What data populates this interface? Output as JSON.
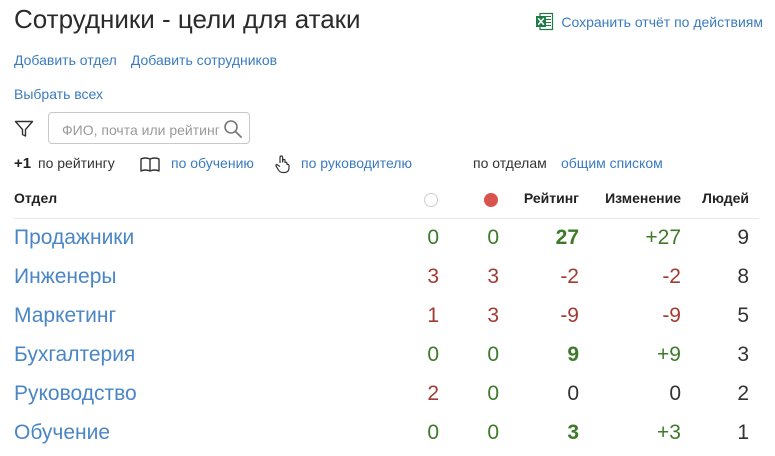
{
  "header": {
    "title": "Сотрудники - цели для атаки",
    "export_label": "Сохранить отчёт по действиям"
  },
  "actions": {
    "add_department": "Добавить отдел",
    "add_employees": "Добавить сотрудников",
    "select_all": "Выбрать всех"
  },
  "search": {
    "placeholder": "ФИО, почта или рейтинг",
    "value": ""
  },
  "sort": {
    "increment": "+1",
    "by_rating": "по рейтингу",
    "by_training": "по обучению",
    "by_manager": "по руководителю",
    "by_departments": "по отделам",
    "general_list": "общим списком"
  },
  "table": {
    "headers": {
      "department": "Отдел",
      "rating": "Рейтинг",
      "change": "Изменение",
      "people": "Людей"
    },
    "rows": [
      {
        "department": "Продажники",
        "col1": "0",
        "col2": "0",
        "rating": "27",
        "change": "+27",
        "people": "9"
      },
      {
        "department": "Инженеры",
        "col1": "3",
        "col2": "3",
        "rating": "-2",
        "change": "-2",
        "people": "8"
      },
      {
        "department": "Маркетинг",
        "col1": "1",
        "col2": "3",
        "rating": "-9",
        "change": "-9",
        "people": "5"
      },
      {
        "department": "Бухгалтерия",
        "col1": "0",
        "col2": "0",
        "rating": "9",
        "change": "+9",
        "people": "3"
      },
      {
        "department": "Руководство",
        "col1": "2",
        "col2": "0",
        "rating": "0",
        "change": "0",
        "people": "2"
      },
      {
        "department": "Обучение",
        "col1": "0",
        "col2": "0",
        "rating": "3",
        "change": "+3",
        "people": "1"
      }
    ]
  },
  "colors": {
    "link": "#3a7bbf",
    "positive": "#3d7a2a",
    "negative": "#a23b32",
    "red_dot": "#d9534f",
    "excel_green": "#1f7a45"
  },
  "icons": {
    "export": "excel-icon",
    "filter": "filter-icon",
    "search": "search-icon",
    "training": "book-icon",
    "manager": "hand-pointer-icon",
    "col1_header": "empty-circle-icon",
    "col2_header": "red-dot-icon"
  }
}
